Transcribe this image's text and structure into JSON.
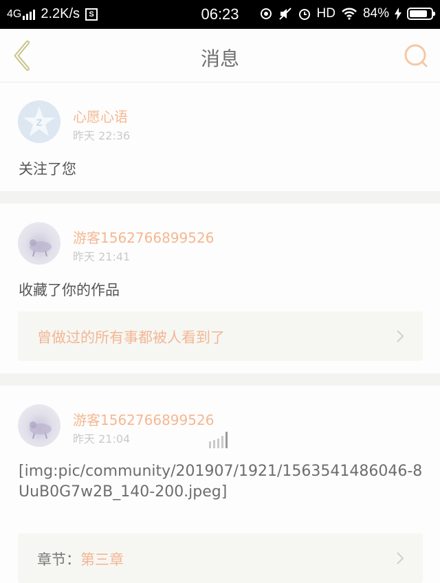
{
  "status_bar": {
    "network": "4G",
    "speed": "2.2K/s",
    "sim_badge": "S",
    "time": "06:23",
    "hd": "HD",
    "battery_percent": "84%",
    "battery_level": 0.84
  },
  "nav": {
    "title": "消息",
    "back_icon": "chevron-left-icon",
    "search_icon": "search-icon"
  },
  "messages": [
    {
      "username": "心愿心语",
      "time": "昨天 22:36",
      "action": "关注了您"
    },
    {
      "username": "游客1562766899526",
      "time": "昨天 21:41",
      "action": "收藏了你的作品",
      "ref_title": "曾做过的所有事都被人看到了"
    },
    {
      "username": "游客1562766899526",
      "time": "昨天 21:04",
      "body": "[img:pic/community/201907/1921/1563541486046-8UuB0G7w2B_140-200.jpeg]",
      "ref_label": "章节：",
      "ref_value": "第三章"
    }
  ],
  "colors": {
    "accent": "#f6b791",
    "back_icon": "#c9c28a",
    "text": "#555555",
    "muted": "#c9c9c9"
  }
}
